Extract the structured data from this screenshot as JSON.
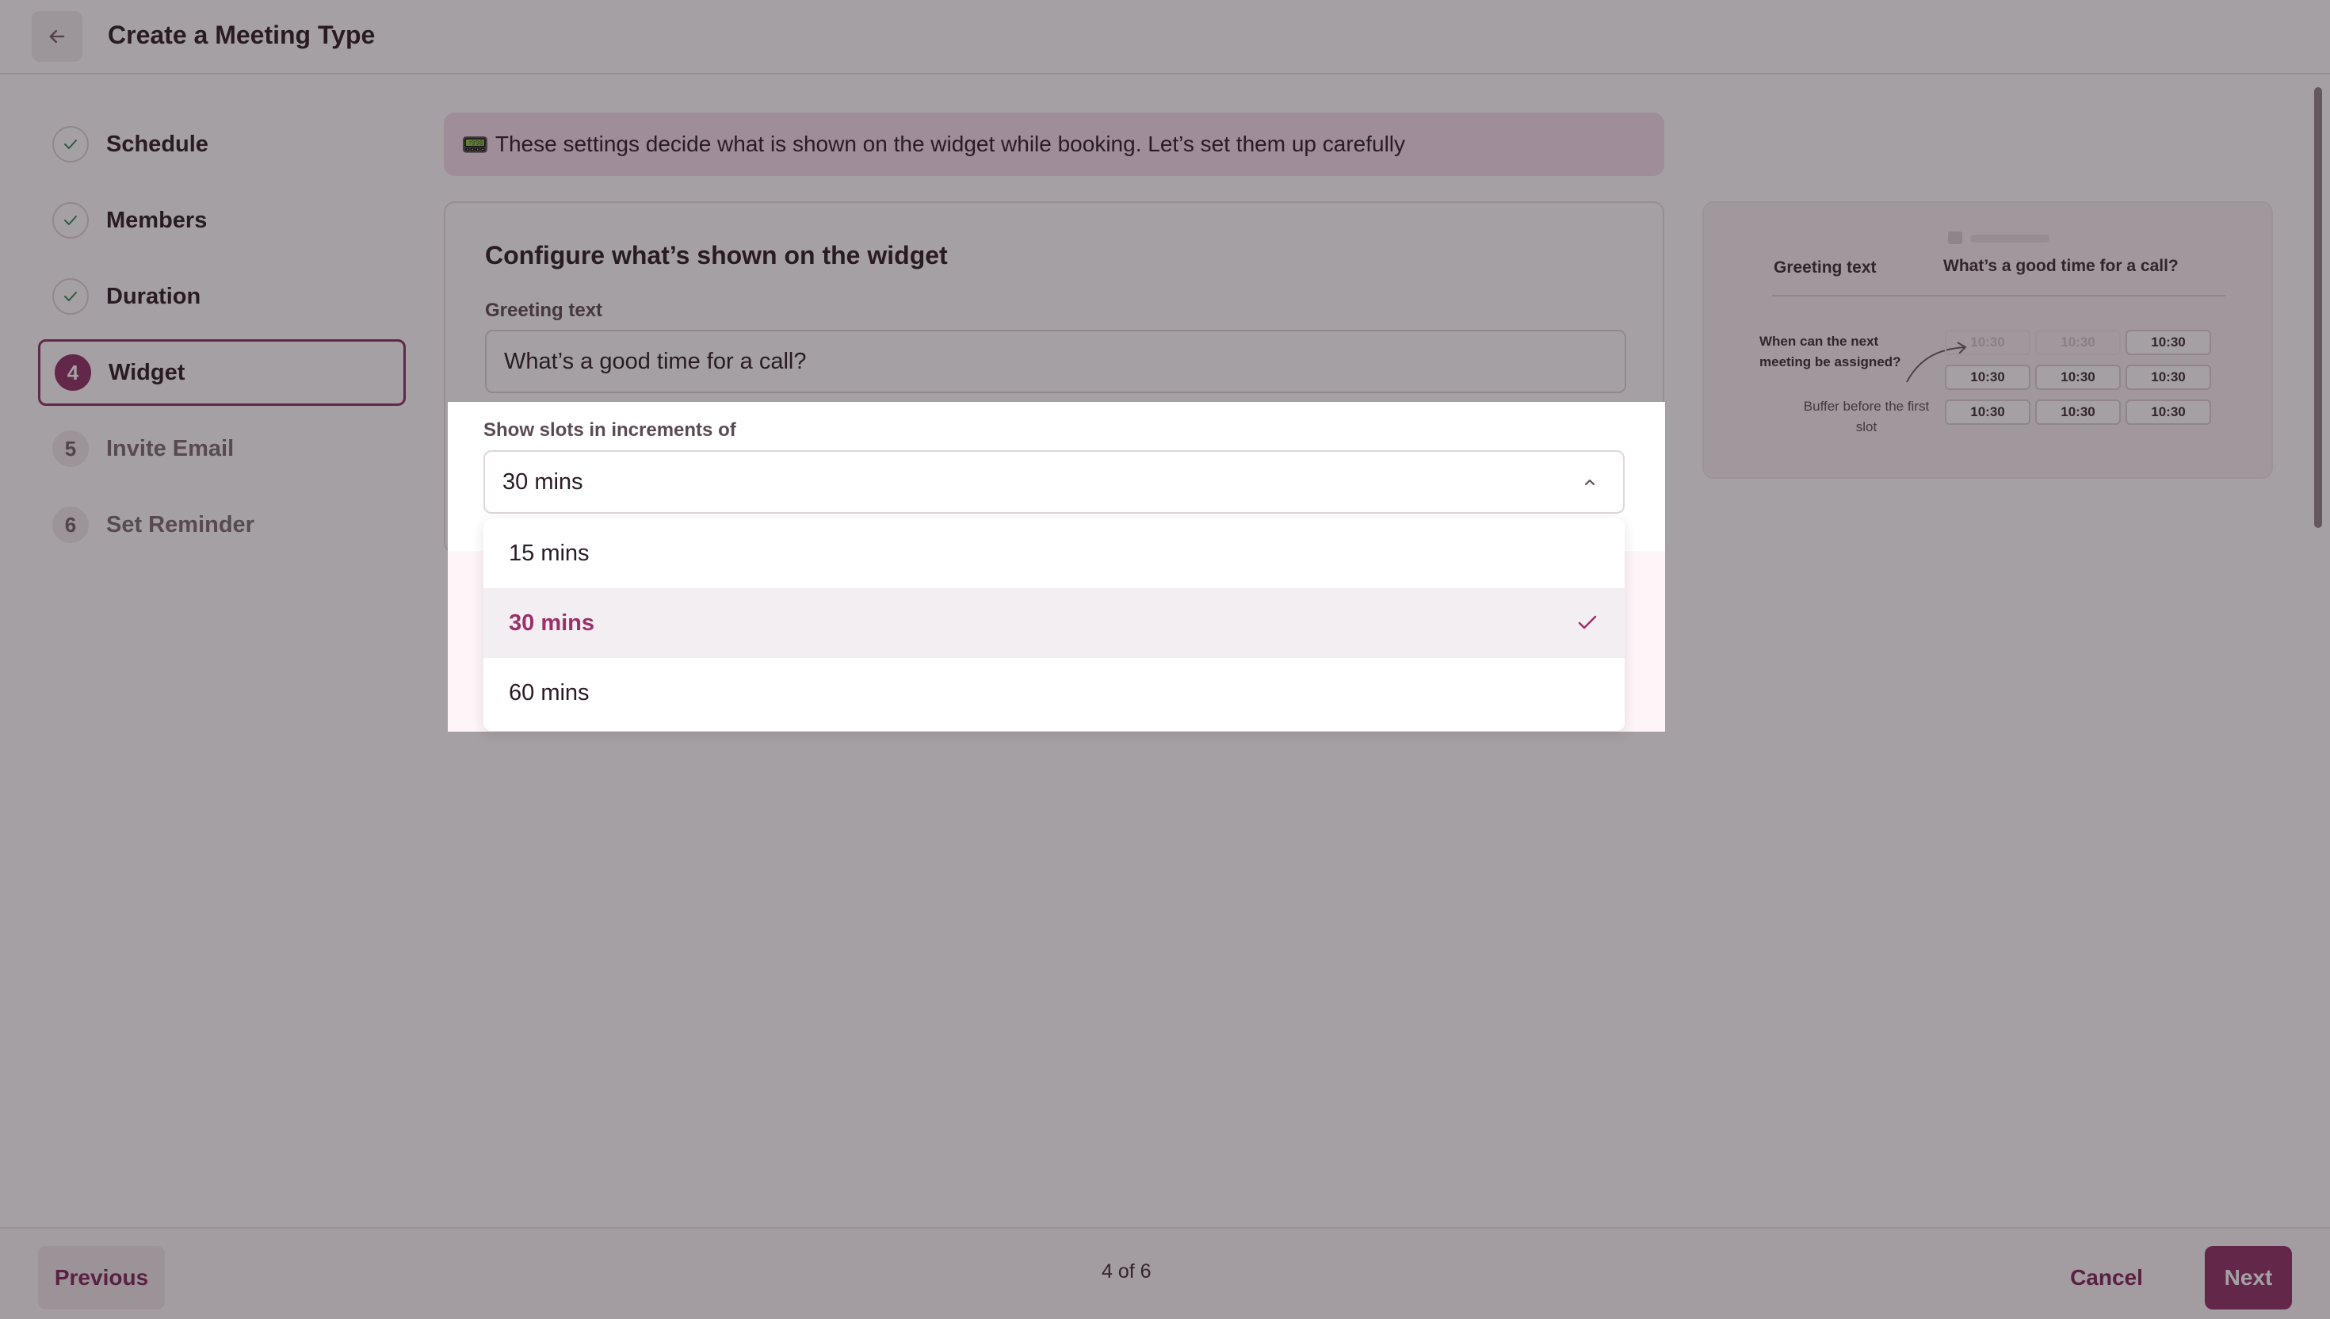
{
  "header": {
    "title": "Create a Meeting Type",
    "back_icon": "arrow-left-icon"
  },
  "steps": [
    {
      "label": "Schedule",
      "status": "done",
      "icon": "check-icon"
    },
    {
      "label": "Members",
      "status": "done",
      "icon": "check-icon"
    },
    {
      "label": "Duration",
      "status": "done",
      "icon": "check-icon"
    },
    {
      "number": "4",
      "label": "Widget",
      "status": "active"
    },
    {
      "number": "5",
      "label": "Invite Email",
      "status": "pending"
    },
    {
      "number": "6",
      "label": "Set Reminder",
      "status": "pending"
    }
  ],
  "banner": {
    "emoji": "📟",
    "text": "These settings decide what is shown on the widget while booking. Let’s set them up carefully"
  },
  "card": {
    "title": "Configure what’s shown on the widget",
    "greeting_label": "Greeting text",
    "greeting_value": "What’s a good time for a call?"
  },
  "increments": {
    "label": "Show slots in increments of",
    "selected": "30 mins",
    "options": [
      "15 mins",
      "30 mins",
      "60 mins"
    ],
    "selected_index": 1
  },
  "preview": {
    "greeting_label": "Greeting text",
    "greeting_value": "What’s a good time for a call?",
    "annotation_next": "When can the next meeting be assigned?",
    "annotation_buffer": "Buffer before the first slot",
    "slot_time": "10:30"
  },
  "footer": {
    "previous": "Previous",
    "step_count": "4 of 6",
    "cancel": "Cancel",
    "next": "Next"
  },
  "colors": {
    "brand": "#8c2f64",
    "banner_bg": "#f5dff0",
    "done_check": "#2f8a5a"
  }
}
